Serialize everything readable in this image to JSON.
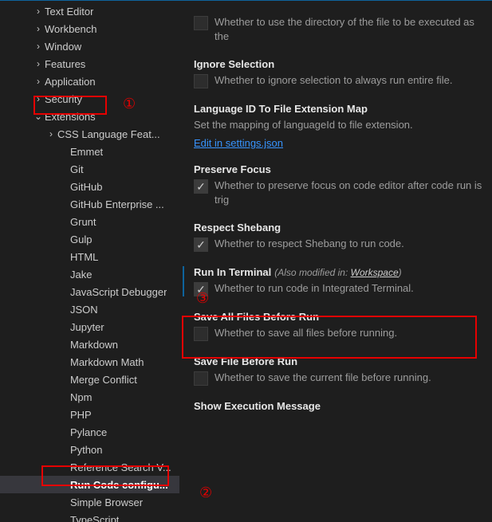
{
  "sidebar": {
    "items": [
      {
        "label": "Text Editor",
        "depth": 0,
        "twisty": ">",
        "selected": false
      },
      {
        "label": "Workbench",
        "depth": 0,
        "twisty": ">",
        "selected": false
      },
      {
        "label": "Window",
        "depth": 0,
        "twisty": ">",
        "selected": false
      },
      {
        "label": "Features",
        "depth": 0,
        "twisty": ">",
        "selected": false
      },
      {
        "label": "Application",
        "depth": 0,
        "twisty": ">",
        "selected": false
      },
      {
        "label": "Security",
        "depth": 0,
        "twisty": ">",
        "selected": false
      },
      {
        "label": "Extensions",
        "depth": 0,
        "twisty": "v",
        "selected": false
      },
      {
        "label": "CSS Language Feat...",
        "depth": 1,
        "twisty": ">",
        "selected": false
      },
      {
        "label": "Emmet",
        "depth": 2,
        "twisty": "",
        "selected": false
      },
      {
        "label": "Git",
        "depth": 2,
        "twisty": "",
        "selected": false
      },
      {
        "label": "GitHub",
        "depth": 2,
        "twisty": "",
        "selected": false
      },
      {
        "label": "GitHub Enterprise ...",
        "depth": 2,
        "twisty": "",
        "selected": false
      },
      {
        "label": "Grunt",
        "depth": 2,
        "twisty": "",
        "selected": false
      },
      {
        "label": "Gulp",
        "depth": 2,
        "twisty": "",
        "selected": false
      },
      {
        "label": "HTML",
        "depth": 2,
        "twisty": "",
        "selected": false
      },
      {
        "label": "Jake",
        "depth": 2,
        "twisty": "",
        "selected": false
      },
      {
        "label": "JavaScript Debugger",
        "depth": 2,
        "twisty": "",
        "selected": false
      },
      {
        "label": "JSON",
        "depth": 2,
        "twisty": "",
        "selected": false
      },
      {
        "label": "Jupyter",
        "depth": 2,
        "twisty": "",
        "selected": false
      },
      {
        "label": "Markdown",
        "depth": 2,
        "twisty": "",
        "selected": false
      },
      {
        "label": "Markdown Math",
        "depth": 2,
        "twisty": "",
        "selected": false
      },
      {
        "label": "Merge Conflict",
        "depth": 2,
        "twisty": "",
        "selected": false
      },
      {
        "label": "Npm",
        "depth": 2,
        "twisty": "",
        "selected": false
      },
      {
        "label": "PHP",
        "depth": 2,
        "twisty": "",
        "selected": false
      },
      {
        "label": "Pylance",
        "depth": 2,
        "twisty": "",
        "selected": false
      },
      {
        "label": "Python",
        "depth": 2,
        "twisty": "",
        "selected": false
      },
      {
        "label": "Reference Search V...",
        "depth": 2,
        "twisty": "",
        "selected": false
      },
      {
        "label": "Run Code configu...",
        "depth": 2,
        "twisty": "",
        "selected": true
      },
      {
        "label": "Simple Browser",
        "depth": 2,
        "twisty": "",
        "selected": false
      },
      {
        "label": "TypeScript",
        "depth": 2,
        "twisty": "",
        "selected": false
      }
    ]
  },
  "settings": [
    {
      "id": "cwd-file-dir",
      "title": "",
      "checkbox": "unchecked",
      "desc": "Whether to use the directory of the file to be executed as the "
    },
    {
      "id": "ignore-selection",
      "title": "Ignore Selection",
      "checkbox": "unchecked",
      "desc": "Whether to ignore selection to always run entire file."
    },
    {
      "id": "lang-id-map",
      "title": "Language ID To File Extension Map",
      "plainDesc": "Set the mapping of languageId to file extension.",
      "link": "Edit in settings.json"
    },
    {
      "id": "preserve-focus",
      "title": "Preserve Focus",
      "checkbox": "checked",
      "desc": "Whether to preserve focus on code editor after code run is trig"
    },
    {
      "id": "respect-shebang",
      "title": "Respect Shebang",
      "checkbox": "checked",
      "desc": "Whether to respect Shebang to run code."
    },
    {
      "id": "run-in-terminal",
      "title": "Run In Terminal",
      "checkbox": "checked",
      "bordered": true,
      "scopePrefix": "(Also modified in: ",
      "scopeLink": "Workspace",
      "scopeSuffix": ")",
      "desc": "Whether to run code in Integrated Terminal."
    },
    {
      "id": "save-all-files",
      "title": "Save All Files Before Run",
      "checkbox": "unchecked",
      "desc": "Whether to save all files before running."
    },
    {
      "id": "save-file",
      "title": "Save File Before Run",
      "checkbox": "unchecked",
      "desc": "Whether to save the current file before running."
    },
    {
      "id": "show-exec-msg",
      "title": "Show Execution Message"
    }
  ],
  "annotations": {
    "n1": "①",
    "n2": "②",
    "n3": "③"
  }
}
